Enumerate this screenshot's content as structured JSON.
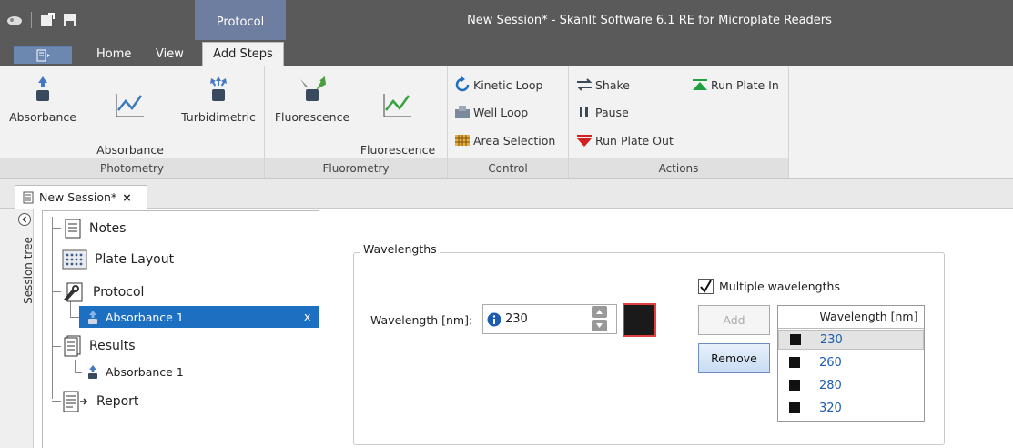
{
  "window": {
    "title": "New Session* - SkanIt Software 6.1 RE for Microplate Readers",
    "context_tab": "Protocol"
  },
  "ribbon_tabs": [
    "Home",
    "View",
    "Add Steps"
  ],
  "ribbon": {
    "photometry": {
      "label": "Photometry",
      "buttons": [
        "Absorbance",
        "Absorbance\nSpectrum",
        "Turbidimetric"
      ]
    },
    "fluorometry": {
      "label": "Fluorometry",
      "buttons": [
        "Fluorescence",
        "Fluorescence\nSpectrum"
      ]
    },
    "control": {
      "label": "Control",
      "buttons": [
        "Kinetic Loop",
        "Well Loop",
        "Area Selection"
      ]
    },
    "actions": {
      "label": "Actions",
      "buttons": [
        "Shake",
        "Pause",
        "Run Plate Out",
        "Run Plate In"
      ]
    }
  },
  "doc_tab": {
    "label": "New Session*",
    "close": "×"
  },
  "session_tree_label": "Session tree",
  "tree": {
    "notes": "Notes",
    "plate_layout": "Plate Layout",
    "protocol": "Protocol",
    "protocol_child": "Absorbance 1",
    "protocol_child_close": "x",
    "results": "Results",
    "results_child": "Absorbance 1",
    "report": "Report"
  },
  "wavelengths": {
    "legend": "Wavelengths",
    "label": "Wavelength [nm]:",
    "value": "230",
    "multiple_label": "Multiple wavelengths",
    "multiple_checked": true,
    "add_label": "Add",
    "remove_label": "Remove",
    "grid_header": "Wavelength [nm]",
    "list": [
      "230",
      "260",
      "280",
      "320"
    ],
    "swatch_color": "#1a1a1a"
  },
  "colors": {
    "accent": "#1d6fc2",
    "titlebar": "#5a5a5a",
    "context": "#6e7ea0"
  }
}
